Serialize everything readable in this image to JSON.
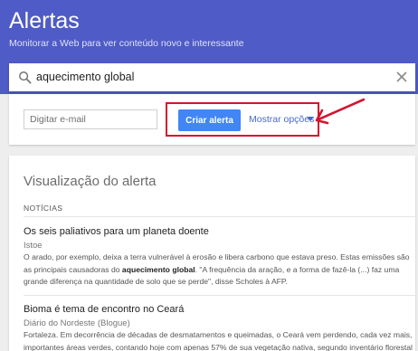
{
  "header": {
    "title": "Alertas",
    "subtitle": "Monitorar a Web para ver conteúdo novo e interessante"
  },
  "search": {
    "query": "aquecimento global"
  },
  "options": {
    "email_placeholder": "Digitar e-mail",
    "create_label": "Criar alerta",
    "show_options_label": "Mostrar opções"
  },
  "preview": {
    "title": "Visualização do alerta",
    "section_label": "NOTÍCIAS",
    "articles": [
      {
        "title": "Os seis paliativos para um planeta doente",
        "source": "Istoe",
        "snippet_a": "O arado, por exemplo, deixa a terra vulnerável à erosão e libera carbono que estava preso. Estas emissões são as principais causadoras do ",
        "snippet_bold": "aquecimento global",
        "snippet_b": ". \"A frequência da aração, e a forma de fazê-la (...) faz uma grande diferença na quantidade de solo que se perde\", disse Scholes à AFP."
      },
      {
        "title": "Bioma é tema de encontro no Ceará",
        "source": "Diário do Nordeste (Blogue)",
        "snippet_a": "Fortaleza. Em decorrência de décadas de desmatamentos e queimadas, o Ceará vem perdendo, cada vez mais, importantes áreas verdes, contando hoje com apenas 57% de sua vegetação nativa, segundo inventário florestal",
        "snippet_bold": "",
        "snippet_b": ""
      }
    ]
  },
  "colors": {
    "header_bg": "#4f5bc6",
    "primary_button": "#4285f4",
    "link": "#4969c8",
    "annotation": "#d3162e"
  }
}
